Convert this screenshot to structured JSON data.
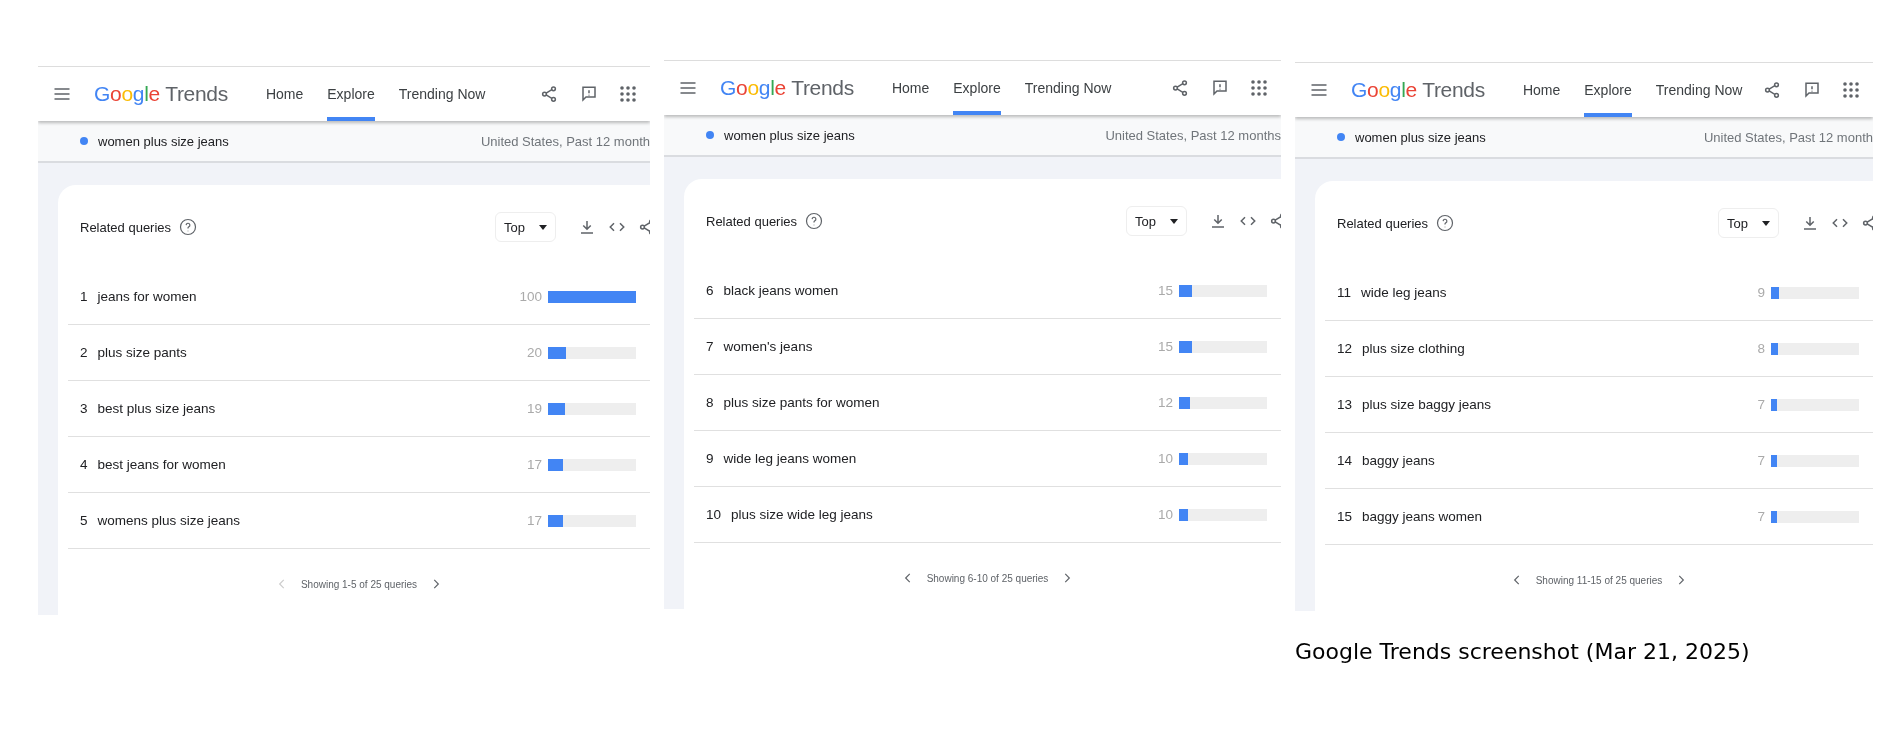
{
  "panels": [
    {
      "logo": {
        "brand": "Google",
        "product": "Trends"
      },
      "nav": [
        {
          "label": "Home",
          "selected": false
        },
        {
          "label": "Explore",
          "selected": true
        },
        {
          "label": "Trending Now",
          "selected": false
        }
      ],
      "search_term": {
        "label": "women plus size jeans",
        "color": "#4285f4",
        "filters": "United States, Past 12 month"
      },
      "card": {
        "title": "Related queries",
        "sort": "Top",
        "rows": [
          {
            "rank": "1",
            "query": "jeans for women",
            "value": "100",
            "level": 1
          },
          {
            "rank": "2",
            "query": "plus size pants",
            "value": "20",
            "level": 0.2
          },
          {
            "rank": "3",
            "query": "best plus size jeans",
            "value": "19",
            "level": 0.19
          },
          {
            "rank": "4",
            "query": "best jeans for women",
            "value": "17",
            "level": 0.17
          },
          {
            "rank": "5",
            "query": "womens plus size jeans",
            "value": "17",
            "level": 0.17
          }
        ],
        "pagination": {
          "text": "Showing 1-5 of 25 queries",
          "prev_disabled": true
        }
      }
    },
    {
      "logo": {
        "brand": "Google",
        "product": "Trends"
      },
      "nav": [
        {
          "label": "Home",
          "selected": false
        },
        {
          "label": "Explore",
          "selected": true
        },
        {
          "label": "Trending Now",
          "selected": false
        }
      ],
      "search_term": {
        "label": "women plus size jeans",
        "color": "#4285f4",
        "filters": "United States, Past 12 months"
      },
      "card": {
        "title": "Related queries",
        "sort": "Top",
        "rows": [
          {
            "rank": "6",
            "query": "black jeans women",
            "value": "15",
            "level": 0.15
          },
          {
            "rank": "7",
            "query": "women's jeans",
            "value": "15",
            "level": 0.15
          },
          {
            "rank": "8",
            "query": "plus size pants for women",
            "value": "12",
            "level": 0.12
          },
          {
            "rank": "9",
            "query": "wide leg jeans women",
            "value": "10",
            "level": 0.1
          },
          {
            "rank": "10",
            "query": "plus size wide leg jeans",
            "value": "10",
            "level": 0.1
          }
        ],
        "pagination": {
          "text": "Showing 6-10 of 25 queries",
          "prev_disabled": false
        }
      }
    },
    {
      "logo": {
        "brand": "Google",
        "product": "Trends"
      },
      "nav": [
        {
          "label": "Home",
          "selected": false
        },
        {
          "label": "Explore",
          "selected": true
        },
        {
          "label": "Trending Now",
          "selected": false
        }
      ],
      "search_term": {
        "label": "women plus size jeans",
        "color": "#4285f4",
        "filters": "United States, Past 12 month"
      },
      "card": {
        "title": "Related queries",
        "sort": "Top",
        "rows": [
          {
            "rank": "11",
            "query": "wide leg jeans",
            "value": "9",
            "level": 0.09
          },
          {
            "rank": "12",
            "query": "plus size clothing",
            "value": "8",
            "level": 0.08
          },
          {
            "rank": "13",
            "query": "plus size baggy jeans",
            "value": "7",
            "level": 0.07
          },
          {
            "rank": "14",
            "query": "baggy jeans",
            "value": "7",
            "level": 0.07
          },
          {
            "rank": "15",
            "query": "baggy jeans women",
            "value": "7",
            "level": 0.07
          }
        ],
        "pagination": {
          "text": "Showing 11-15 of 25 queries",
          "prev_disabled": false
        }
      }
    }
  ],
  "caption": "Google Trends screenshot (Mar 21, 2025)"
}
